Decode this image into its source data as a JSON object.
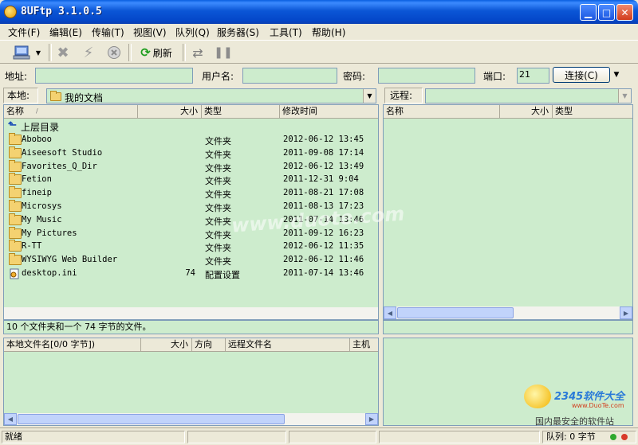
{
  "window": {
    "title": "8UFtp 3.1.0.5"
  },
  "menu": [
    "文件(F)",
    "编辑(E)",
    "传输(T)",
    "视图(V)",
    "队列(Q)",
    "服务器(S)",
    "工具(T)",
    "帮助(H)"
  ],
  "toolbar": {
    "refresh_label": "刷新"
  },
  "connection": {
    "address_label": "地址:",
    "address_value": "",
    "username_label": "用户名:",
    "username_value": "",
    "password_label": "密码:",
    "password_value": "",
    "port_label": "端口:",
    "port_value": "21",
    "connect_label": "连接(C)"
  },
  "local": {
    "label": "本地:",
    "path": "我的文档",
    "columns": [
      "名称",
      "大小",
      "类型",
      "修改时间"
    ],
    "up_label": "上层目录",
    "files": [
      {
        "name": "Aboboo",
        "size": "",
        "type": "文件夹",
        "date": "2012-06-12 13:45",
        "icon": "folder-icon"
      },
      {
        "name": "Aiseesoft Studio",
        "size": "",
        "type": "文件夹",
        "date": "2011-09-08 17:14",
        "icon": "folder-icon"
      },
      {
        "name": "Favorites_Q_Dir",
        "size": "",
        "type": "文件夹",
        "date": "2012-06-12 13:49",
        "icon": "folder-icon"
      },
      {
        "name": "Fetion",
        "size": "",
        "type": "文件夹",
        "date": "2011-12-31 9:04",
        "icon": "folder-icon"
      },
      {
        "name": "fineip",
        "size": "",
        "type": "文件夹",
        "date": "2011-08-21 17:08",
        "icon": "folder-icon"
      },
      {
        "name": "Microsys",
        "size": "",
        "type": "文件夹",
        "date": "2011-08-13 17:23",
        "icon": "folder-icon"
      },
      {
        "name": "My Music",
        "size": "",
        "type": "文件夹",
        "date": "2011-07-14 13:46",
        "icon": "music-folder-icon"
      },
      {
        "name": "My Pictures",
        "size": "",
        "type": "文件夹",
        "date": "2011-09-12 16:23",
        "icon": "pictures-folder-icon"
      },
      {
        "name": "R-TT",
        "size": "",
        "type": "文件夹",
        "date": "2012-06-12 11:35",
        "icon": "folder-icon"
      },
      {
        "name": "WYSIWYG Web Builder",
        "size": "",
        "type": "文件夹",
        "date": "2012-06-12 11:46",
        "icon": "folder-icon"
      },
      {
        "name": "desktop.ini",
        "size": "74",
        "type": "配置设置",
        "date": "2011-07-14 13:46",
        "icon": "ini-file-icon"
      }
    ],
    "status": "10 个文件夹和一个 74 字节的文件。"
  },
  "remote": {
    "label": "远程:",
    "path": "",
    "columns": [
      "名称",
      "大小",
      "类型"
    ]
  },
  "queue": {
    "columns": [
      "本地文件名[0/0 字节])",
      "大小",
      "方向",
      "远程文件名",
      "主机"
    ]
  },
  "status": {
    "ready": "就绪",
    "queue": "队列: 0 字节"
  },
  "watermark": {
    "text": "www.duote.com",
    "brand": "2345软件大全",
    "brand_url": "www.DuoTe.com",
    "brand_tag": "国内最安全的软件站"
  },
  "colors": {
    "pane_bg": "#cdeccd",
    "titlebar": "#0b56d6",
    "chrome": "#ece9d8"
  }
}
